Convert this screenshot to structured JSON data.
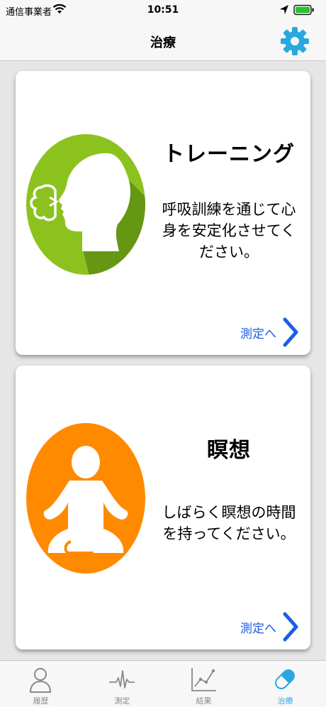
{
  "status_bar": {
    "carrier": "通信事業者",
    "time": "10:51"
  },
  "nav": {
    "title": "治療"
  },
  "cards": [
    {
      "title": "トレーニング",
      "description_lines": [
        "呼吸訓練を通じて心",
        "身を安定化させてく",
        "ださい。"
      ],
      "link_label": "測定へ"
    },
    {
      "title": "瞑想",
      "description_lines": [
        "しばらく瞑想の時間",
        "を持ってください。"
      ],
      "link_label": "測定へ"
    }
  ],
  "tabs": [
    {
      "label": "履歴",
      "icon": "person-icon"
    },
    {
      "label": "測定",
      "icon": "pulse-icon"
    },
    {
      "label": "結果",
      "icon": "line-chart-icon"
    },
    {
      "label": "治療",
      "icon": "pill-icon",
      "active": true
    }
  ],
  "colors": {
    "accent": "#29a8e0",
    "link": "#1a5ee6",
    "training": "#8cc21e",
    "meditation": "#ff8a00"
  }
}
